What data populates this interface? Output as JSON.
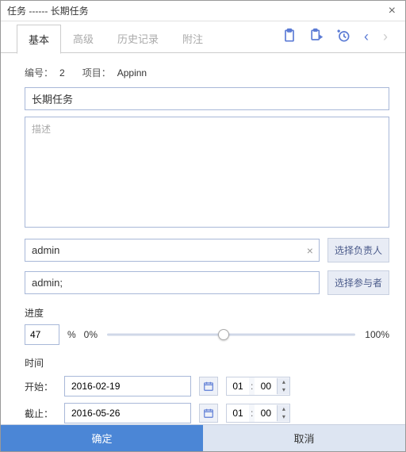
{
  "window": {
    "title": "任务 ------ 长期任务"
  },
  "tabs": {
    "basic": "基本",
    "advanced": "高级",
    "history": "历史记录",
    "notes": "附注"
  },
  "meta": {
    "id_label": "编号：",
    "id_value": "2",
    "project_label": "项目：",
    "project_value": "Appinn"
  },
  "fields": {
    "name_value": "长期任务",
    "desc_placeholder": "描述",
    "owner_value": "admin",
    "participants_value": "admin;",
    "select_owner_btn": "选择负责人",
    "select_participants_btn": "选择参与者"
  },
  "progress": {
    "label": "进度",
    "value": "47",
    "percent_sign": "%",
    "min_label": "0%",
    "max_label": "100%",
    "percent": 47
  },
  "time": {
    "label": "时间",
    "start_label": "开始：",
    "end_label": "截止：",
    "start_date": "2016-02-19",
    "end_date": "2016-05-26",
    "start_hour": "01",
    "start_min": "00",
    "end_hour": "01",
    "end_min": "00",
    "colon": ":"
  },
  "footer": {
    "ok": "确定",
    "cancel": "取消"
  }
}
